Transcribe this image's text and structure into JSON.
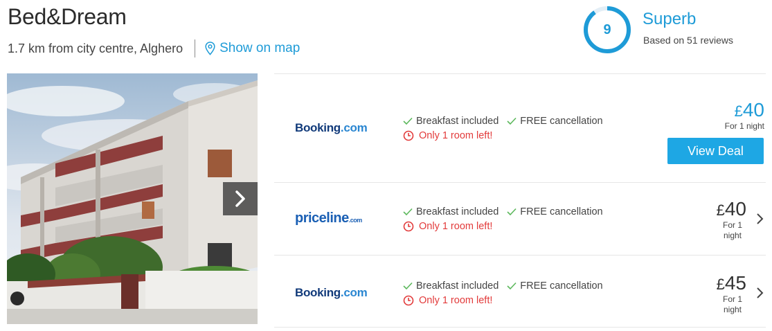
{
  "hotel": {
    "name": "Bed&Dream",
    "location": "1.7 km from city centre, Alghero",
    "map_link": "Show on map"
  },
  "rating": {
    "score": "9",
    "label": "Superb",
    "reviews": "Based on 51 reviews"
  },
  "deals": [
    {
      "provider": "Booking.com",
      "logo_parts": [
        "Booking",
        ".com"
      ],
      "amenities": [
        "Breakfast included",
        "FREE cancellation"
      ],
      "scarcity": "Only 1 room left!",
      "currency": "£",
      "price": "40",
      "per_night": "For 1 night",
      "button": "View Deal"
    },
    {
      "provider": "priceline.com",
      "logo_parts": [
        "priceline",
        ".com"
      ],
      "amenities": [
        "Breakfast included",
        "FREE cancellation"
      ],
      "scarcity": "Only 1 room left!",
      "currency": "£",
      "price": "40",
      "per_night": "For 1 night"
    },
    {
      "provider": "Booking.com",
      "logo_parts": [
        "Booking",
        ".com"
      ],
      "amenities": [
        "Breakfast included",
        "FREE cancellation"
      ],
      "scarcity": "Only 1 room left!",
      "currency": "£",
      "price": "45",
      "per_night": "For 1 night"
    }
  ],
  "icons": {
    "map": "map-pin-icon",
    "next": "chevron-right-icon",
    "check": "check-icon",
    "clock": "clock-icon"
  },
  "colors": {
    "accent": "#1e9bd7",
    "button": "#1ea7e4",
    "check": "#5cb85c",
    "alert": "#e23b3b"
  }
}
